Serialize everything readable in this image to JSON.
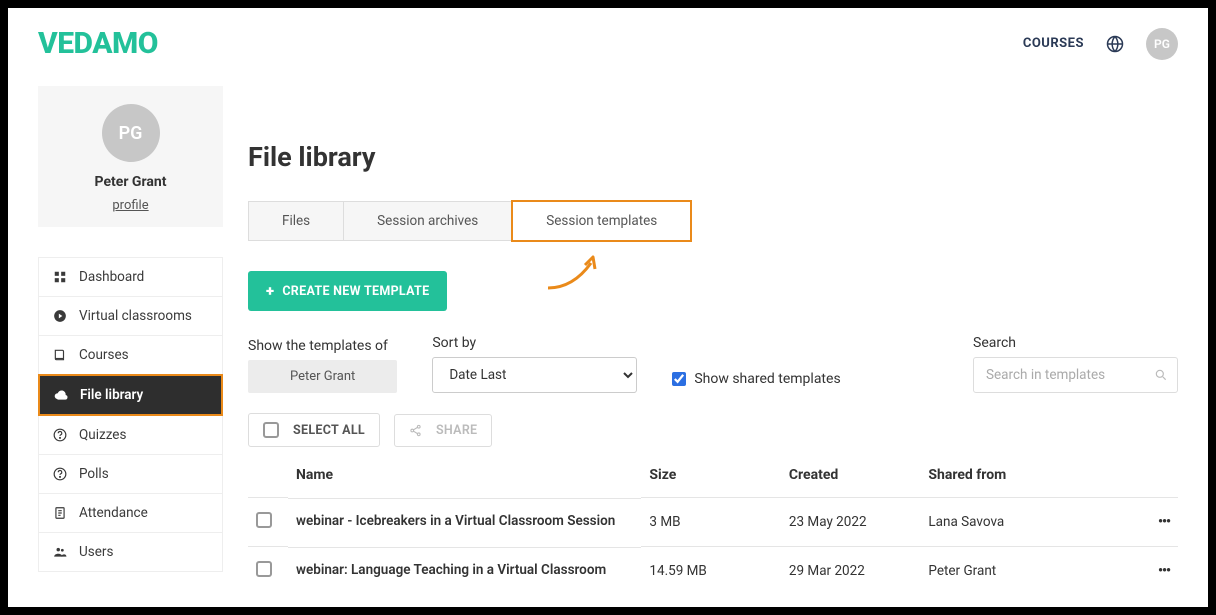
{
  "brand": "VEDAMO",
  "top": {
    "courses": "COURSES",
    "avatar": "PG"
  },
  "profile": {
    "initials": "PG",
    "name": "Peter Grant",
    "link": "profile"
  },
  "nav": {
    "items": [
      {
        "label": "Dashboard"
      },
      {
        "label": "Virtual classrooms"
      },
      {
        "label": "Courses"
      },
      {
        "label": "File library"
      },
      {
        "label": "Quizzes"
      },
      {
        "label": "Polls"
      },
      {
        "label": "Attendance"
      },
      {
        "label": "Users"
      }
    ]
  },
  "page": {
    "title": "File library"
  },
  "tabs": {
    "files": "Files",
    "archives": "Session archives",
    "templates": "Session templates"
  },
  "create_btn": "CREATE NEW TEMPLATE",
  "filters": {
    "owner_label": "Show the templates of",
    "owner_value": "Peter Grant",
    "sort_label": "Sort by",
    "sort_value": "Date Last",
    "shared_label": "Show shared templates",
    "search_label": "Search",
    "search_placeholder": "Search in templates"
  },
  "bulk": {
    "select_all": "SELECT ALL",
    "share": "SHARE"
  },
  "columns": {
    "name": "Name",
    "size": "Size",
    "created": "Created",
    "shared": "Shared from"
  },
  "rows": [
    {
      "name": "webinar - Icebreakers in a Virtual Classroom Session",
      "size": "3 MB",
      "created": "23 May 2022",
      "shared": "Lana Savova"
    },
    {
      "name": "webinar: Language Teaching in a Virtual Classroom",
      "size": "14.59 MB",
      "created": "29 Mar 2022",
      "shared": "Peter Grant"
    }
  ]
}
